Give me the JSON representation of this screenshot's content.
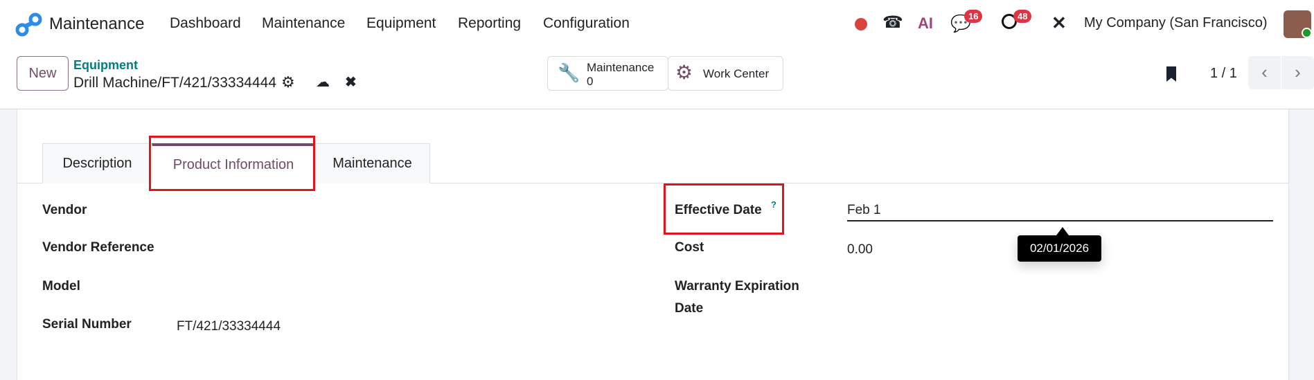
{
  "navbar": {
    "app_name": "Maintenance",
    "menu": [
      "Dashboard",
      "Maintenance",
      "Equipment",
      "Reporting",
      "Configuration"
    ],
    "messages_count": "16",
    "activities_count": "48",
    "ai_label": "AI",
    "company": "My Company (San Francisco)"
  },
  "control_panel": {
    "new_label": "New",
    "breadcrumb_parent": "Equipment",
    "record_name": "Drill Machine/FT/421/33334444",
    "smart_buttons": {
      "maintenance_label": "Maintenance",
      "maintenance_count": "0",
      "work_center_label": "Work Center"
    },
    "pager": "1 / 1"
  },
  "tabs": [
    "Description",
    "Product Information",
    "Maintenance"
  ],
  "form": {
    "left": [
      {
        "label": "Vendor",
        "value": ""
      },
      {
        "label": "Vendor Reference",
        "value": ""
      },
      {
        "label": "Model",
        "value": ""
      },
      {
        "label": "Serial Number",
        "value": "FT/421/33334444"
      }
    ],
    "right": {
      "effective_date_label": "Effective Date",
      "help_mark": "?",
      "effective_date_value": "Feb 1",
      "tooltip": "02/01/2026",
      "cost_label": "Cost",
      "cost_value": "0.00",
      "warranty_label_1": "Warranty Expiration",
      "warranty_label_2": "Date"
    }
  },
  "colors": {
    "accent": "#714b67",
    "link": "#017e84",
    "annotation": "#e3131b"
  }
}
